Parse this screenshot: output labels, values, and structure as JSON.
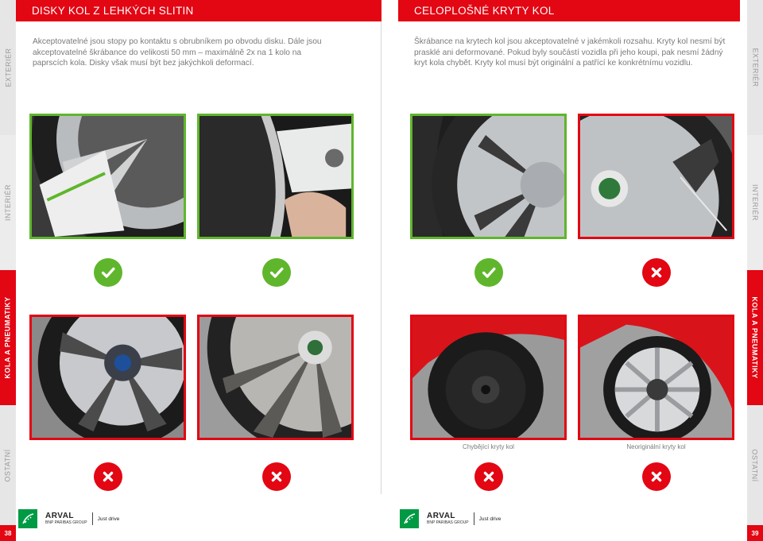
{
  "rails": {
    "left": [
      "EXTERIÉR",
      "INTERIÉR",
      "KOLA A PNEUMATIKY",
      "OSTATNÍ"
    ],
    "right": [
      "EXTERIÉR",
      "INTERIÉR",
      "KOLA A PNEUMATIKY",
      "OSTATNÍ"
    ]
  },
  "pages": {
    "left_number": "38",
    "right_number": "39"
  },
  "left_section": {
    "title": "DISKY KOL Z LEHKÝCH SLITIN",
    "description": "Akceptovatelné jsou stopy po kontaktu s obrubníkem po obvodu disku. Dále jsou akceptovatelné škrábance do velikosti 50 mm – maximálně 2x na 1 kolo na paprscích kola. Disky však musí být bez jakýchkoli deformací.",
    "top_photos": [
      {
        "status": "acceptable"
      },
      {
        "status": "acceptable"
      }
    ],
    "bottom_photos": [
      {
        "status": "not-acceptable"
      },
      {
        "status": "not-acceptable"
      }
    ]
  },
  "right_section": {
    "title": "CELOPLOŠNÉ KRYTY KOL",
    "description": "Škrábance na krytech kol jsou akceptovatelné v jakémkoli rozsahu. Kryty kol nesmí být prasklé ani deformované. Pokud byly součástí vozidla při jeho koupi, pak nesmí žádný kryt kola chybět. Kryty kol musí být originální a patřící ke konkrétnímu vozidlu.",
    "top_photos": [
      {
        "status": "acceptable"
      },
      {
        "status": "not-acceptable"
      }
    ],
    "bottom_photos": [
      {
        "status": "not-acceptable",
        "caption": "Chybějící kryty kol"
      },
      {
        "status": "not-acceptable",
        "caption": "Neoriginální kryty kol"
      }
    ]
  },
  "footer": {
    "brand": "ARVAL",
    "group": "BNP PARIBAS GROUP",
    "slogan": "Just drive"
  },
  "colors": {
    "red": "#e30613",
    "green": "#5fb62c",
    "arval_green": "#009a44",
    "grey_text": "#7a7a7a"
  },
  "icons": {
    "acceptable": "check-icon",
    "not_acceptable": "cross-icon"
  }
}
